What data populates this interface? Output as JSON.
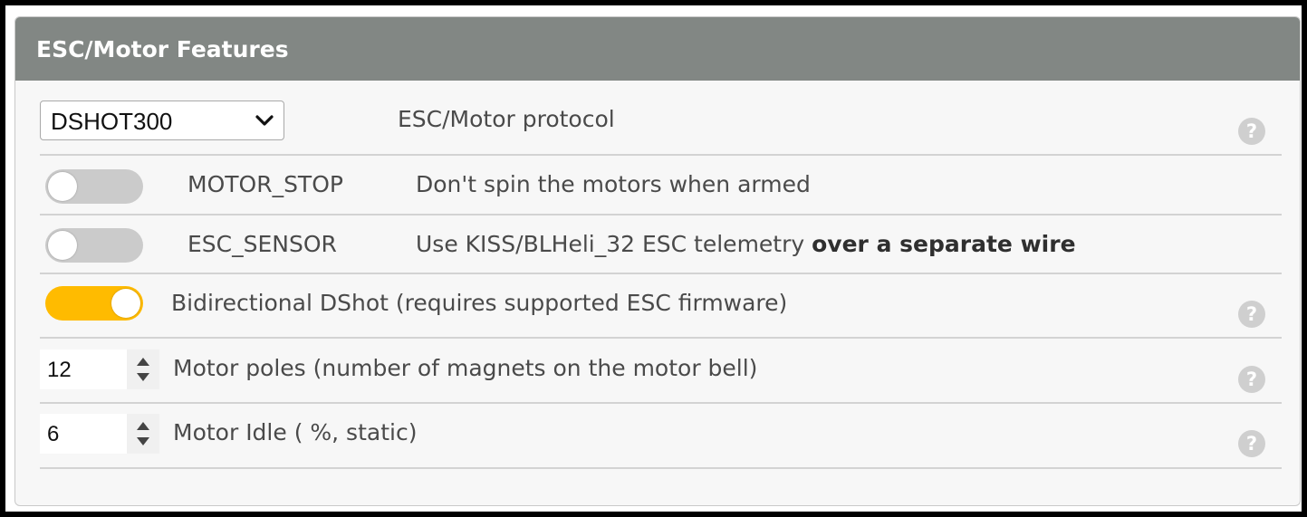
{
  "panel": {
    "title": "ESC/Motor Features"
  },
  "protocol": {
    "selected": "DSHOT300",
    "label": "ESC/Motor protocol",
    "help": "?"
  },
  "motor_stop": {
    "enabled": false,
    "name": "MOTOR_STOP",
    "description": "Don't spin the motors when armed"
  },
  "esc_sensor": {
    "enabled": false,
    "name": "ESC_SENSOR",
    "description_plain": "Use KISS/BLHeli_32 ESC telemetry ",
    "description_bold": "over a separate wire"
  },
  "bidir_dshot": {
    "enabled": true,
    "label": "Bidirectional DShot (requires supported ESC firmware)",
    "help": "?"
  },
  "motor_poles": {
    "value": "12",
    "label": "Motor poles (number of magnets on the motor bell)",
    "help": "?"
  },
  "motor_idle": {
    "value": "6",
    "label": "Motor Idle ( %, static)",
    "help": "?"
  },
  "colors": {
    "header": "#828784",
    "toggle_on": "#ffbb00",
    "toggle_off": "#cbcbcb"
  },
  "icons": {
    "select_arrow": "chevron-down-icon",
    "help": "question-circle-icon",
    "spinner": "up-down-arrows-icon"
  }
}
